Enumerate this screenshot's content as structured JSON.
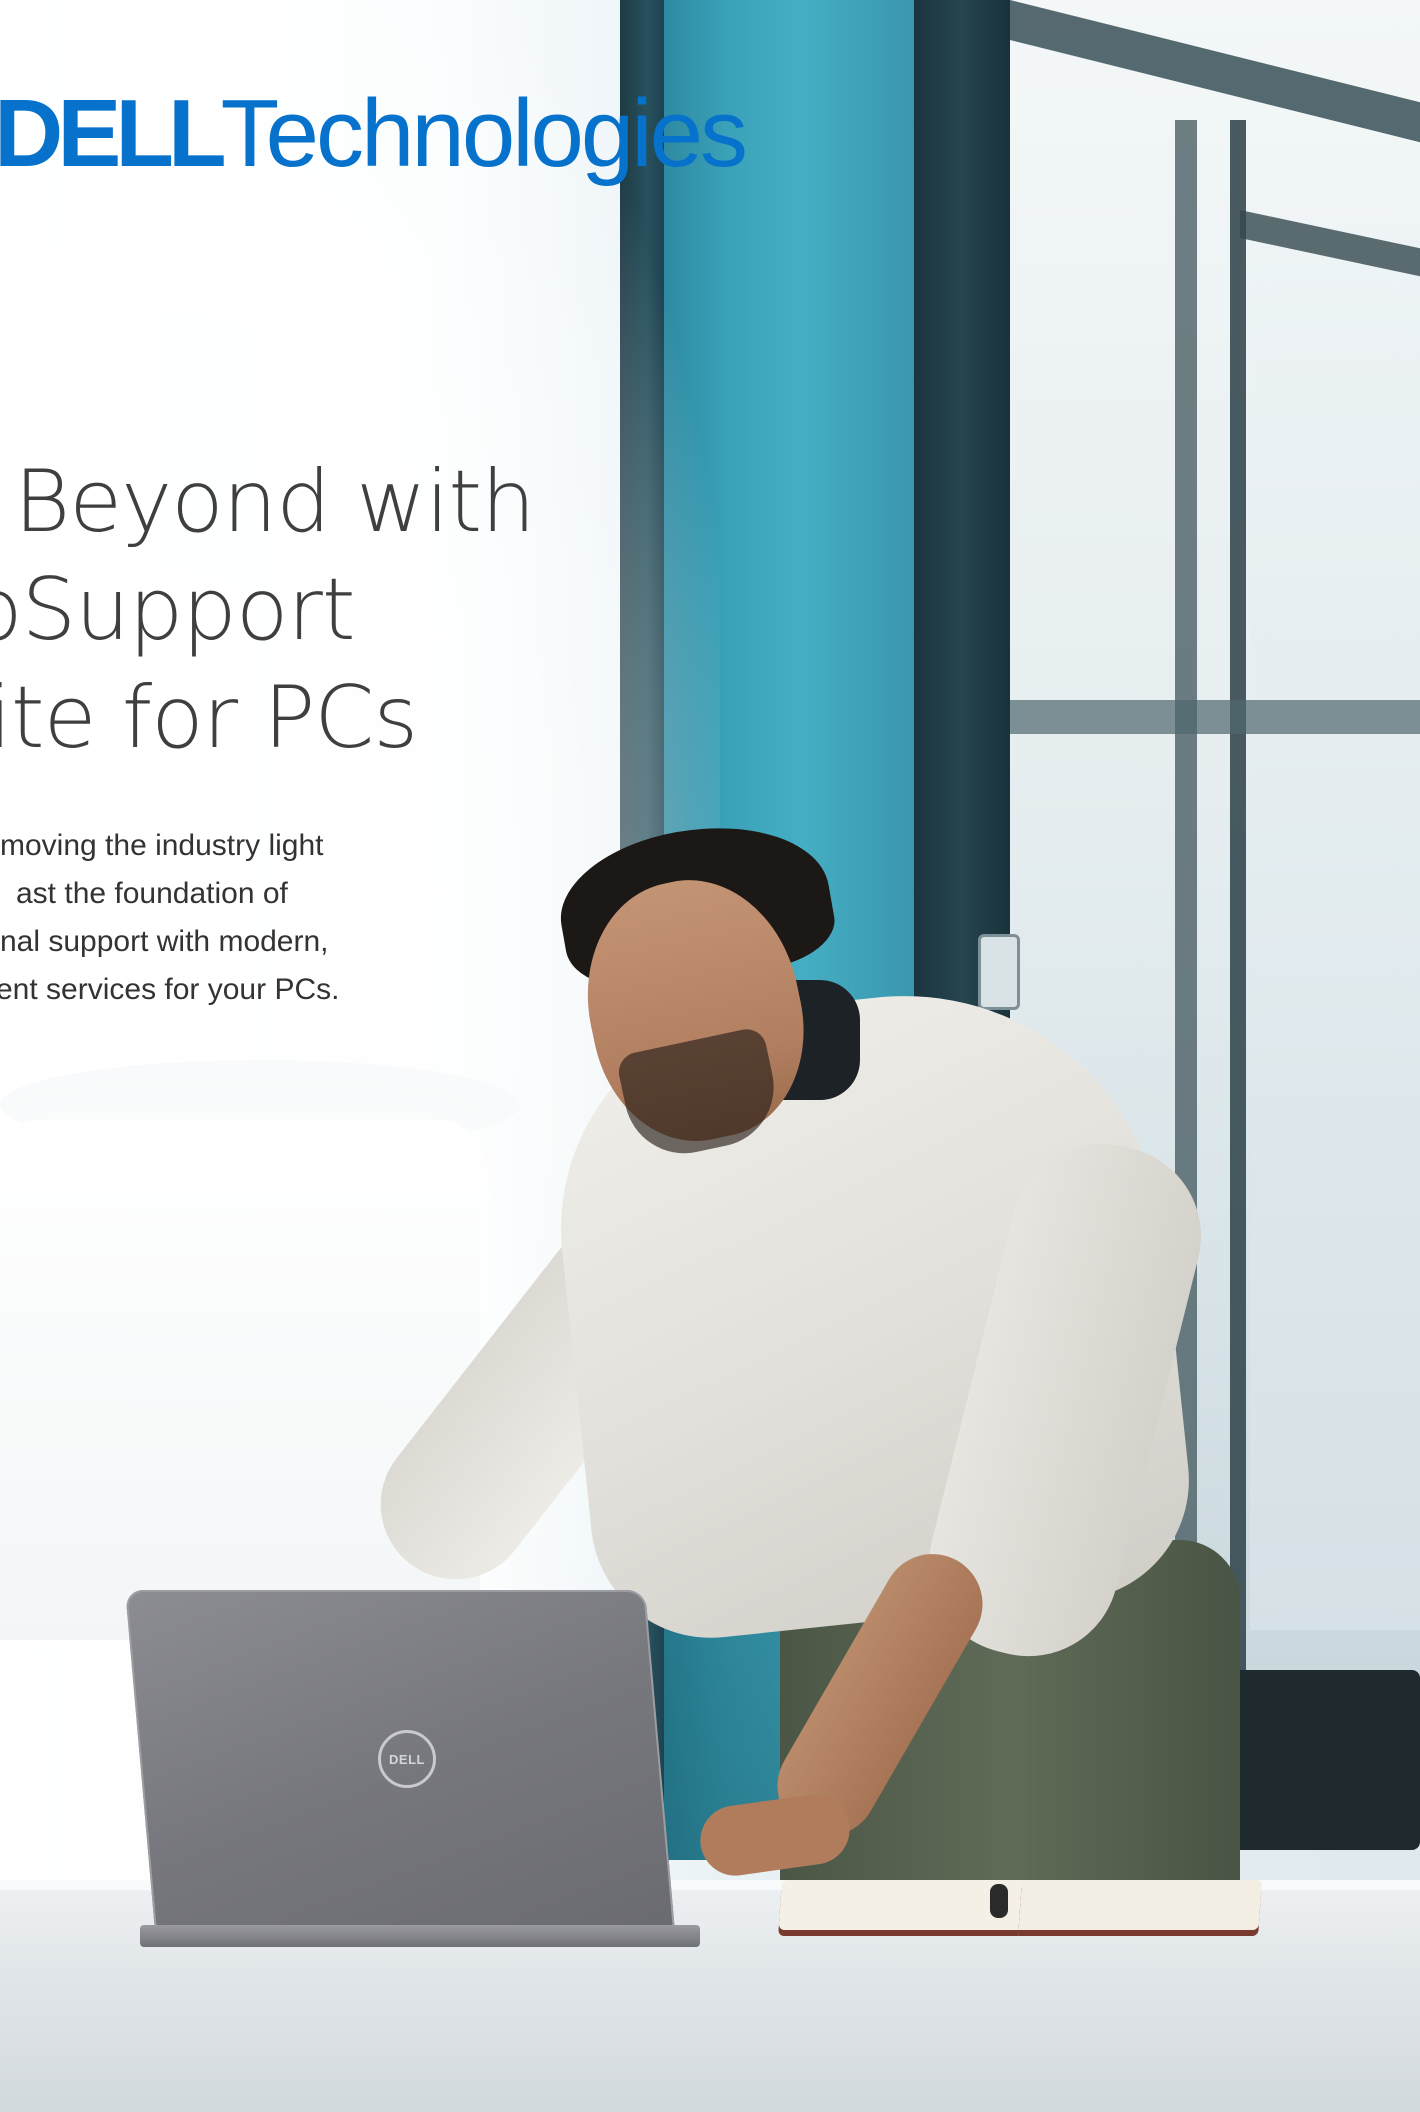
{
  "brand": {
    "logo_brand": "DELL",
    "logo_suffix": "Technologies",
    "accent_color": "#0672cb"
  },
  "headline": {
    "lines": [
      "Beyond with",
      "oSupport",
      "ite for PCs"
    ]
  },
  "intro": {
    "lines": [
      "moving the industry light",
      "ast the foundation of",
      "nal support with modern,",
      "ent services for your PCs."
    ]
  },
  "photo": {
    "laptop_logo": "DELL"
  }
}
